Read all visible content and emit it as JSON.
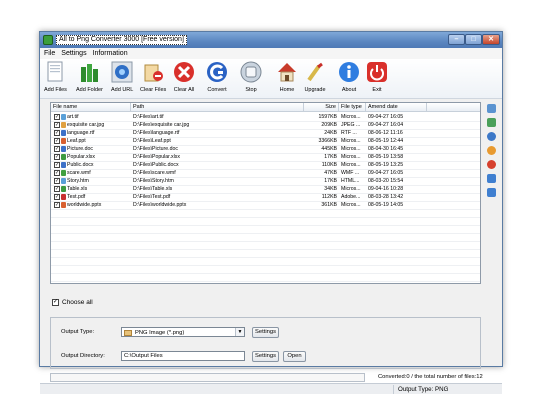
{
  "window": {
    "title": "All to Png Converter 3000 [Free version]"
  },
  "menu": [
    "File",
    "Settings",
    "Information"
  ],
  "toolbar": [
    {
      "label": "Add Files",
      "icon": "add-files-icon"
    },
    {
      "label": "Add Folder",
      "icon": "add-folder-icon"
    },
    {
      "label": "Add URL",
      "icon": "add-url-icon"
    },
    {
      "label": "Clear Files",
      "icon": "clear-files-icon"
    },
    {
      "label": "Clear All",
      "icon": "clear-all-icon"
    },
    {
      "label": "Convert",
      "icon": "convert-icon"
    },
    {
      "label": "Stop",
      "icon": "stop-icon"
    },
    {
      "label": "Home",
      "icon": "home-icon"
    },
    {
      "label": "Upgrade",
      "icon": "upgrade-icon"
    },
    {
      "label": "About",
      "icon": "about-icon"
    },
    {
      "label": "Exit",
      "icon": "exit-icon"
    }
  ],
  "file_list": {
    "columns": [
      "File name",
      "Path",
      "Size",
      "File type",
      "Amend date"
    ],
    "rows": [
      {
        "name": "art.tif",
        "path": "D:\\Files\\art.tif",
        "size": "1597KB",
        "type": "Micros...",
        "date": "09-04-27 16:05",
        "color": "#5aa0d8"
      },
      {
        "name": "exquisite car.jpg",
        "path": "D:\\Files\\exquisite car.jpg",
        "size": "209KB",
        "type": "JPEG ...",
        "date": "09-04-27 16:04",
        "color": "#e0a040"
      },
      {
        "name": "language.rtf",
        "path": "D:\\Files\\language.rtf",
        "size": "24KB",
        "type": "RTF ...",
        "date": "08-06-12 11:16",
        "color": "#3c70c8"
      },
      {
        "name": "Leaf.ppt",
        "path": "D:\\Files\\Leaf.ppt",
        "size": "3366KB",
        "type": "Micros...",
        "date": "08-05-19 12:44",
        "color": "#d86030"
      },
      {
        "name": "Picture.doc",
        "path": "D:\\Files\\Picture.doc",
        "size": "445KB",
        "type": "Micros...",
        "date": "08-04-30 16:45",
        "color": "#3c70c8"
      },
      {
        "name": "Popular.xlsx",
        "path": "D:\\Files\\Popular.xlsx",
        "size": "17KB",
        "type": "Micros...",
        "date": "08-05-19 13:58",
        "color": "#3c9a40"
      },
      {
        "name": "Public.docx",
        "path": "D:\\Files\\Public.docx",
        "size": "110KB",
        "type": "Micros...",
        "date": "08-05-19 13:25",
        "color": "#3c70c8"
      },
      {
        "name": "scare.wmf",
        "path": "D:\\Files\\scare.wmf",
        "size": "47KB",
        "type": "WMF ...",
        "date": "09-04-27 16:05",
        "color": "#40a040"
      },
      {
        "name": "Story.htm",
        "path": "D:\\Files\\Story.htm",
        "size": "17KB",
        "type": "HTML...",
        "date": "08-03-20 15:54",
        "color": "#5aa0d8"
      },
      {
        "name": "Table.xls",
        "path": "D:\\Files\\Table.xls",
        "size": "34KB",
        "type": "Micros...",
        "date": "09-04-16 10:28",
        "color": "#3c9a40"
      },
      {
        "name": "Test.pdf",
        "path": "D:\\Files\\Test.pdf",
        "size": "112KB",
        "type": "Adobe...",
        "date": "08-03-28 13:42",
        "color": "#c83030"
      },
      {
        "name": "worldwide.pptx",
        "path": "D:\\Files\\worldwide.pptx",
        "size": "361KB",
        "type": "Micros...",
        "date": "08-05-19 14:05",
        "color": "#d86030"
      }
    ]
  },
  "side_icons": [
    "list-view-icon",
    "photo-icon",
    "globe-icon",
    "orange-ball-icon",
    "red-ball-icon",
    "move-up-icon",
    "move-down-icon"
  ],
  "choose_all": {
    "label": "Choose all",
    "checked": true
  },
  "output": {
    "type_label": "Output Type:",
    "type_value": "PNG Image (*.png)",
    "type_settings": "Settings",
    "dir_label": "Output Directory:",
    "dir_value": "C:\\Output Files",
    "dir_settings": "Settings",
    "dir_open": "Open"
  },
  "status": {
    "converted": "Converted:0  /  the total number of files:12",
    "output_type": "Output Type: PNG",
    "progress_percent": 0
  }
}
